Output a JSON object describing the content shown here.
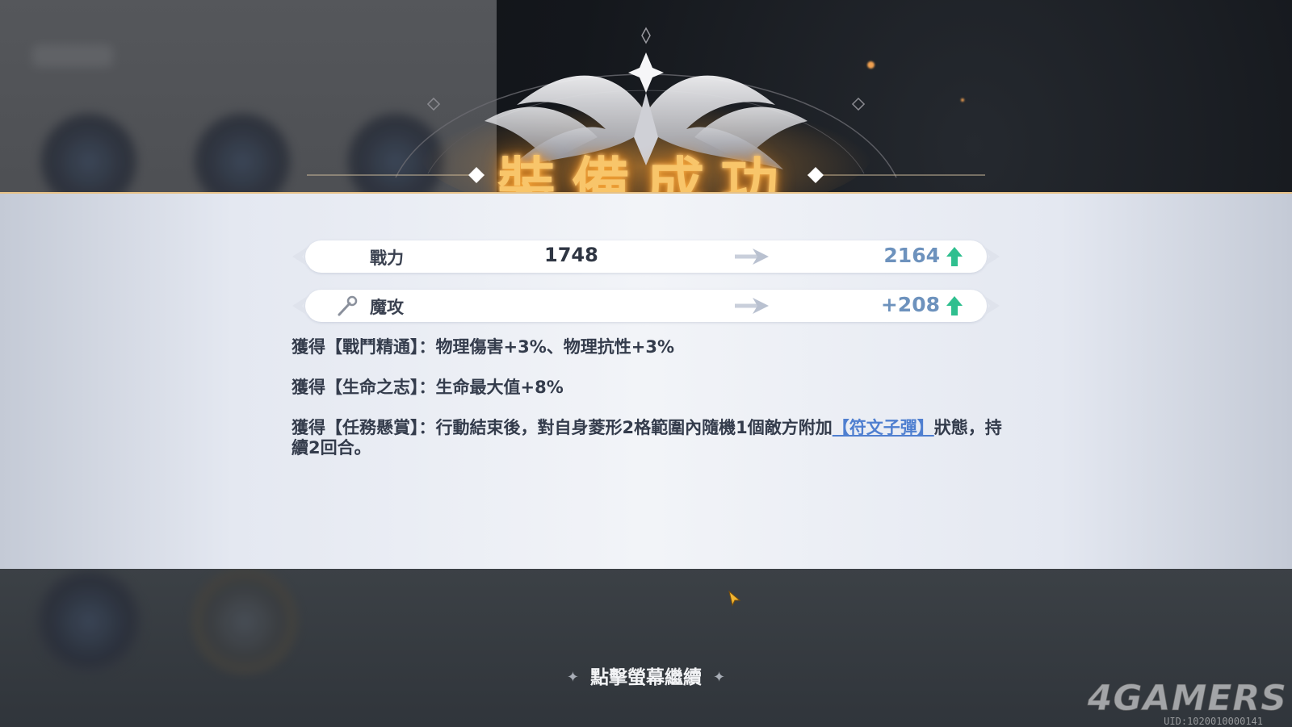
{
  "title": "裝備成功",
  "stats": [
    {
      "label": "戰力",
      "old_value": "1748",
      "new_value": "2164",
      "icon": "none",
      "trend": "up-arrow-icon"
    },
    {
      "label": "魔攻",
      "old_value": "",
      "new_value": "+208",
      "icon": "wand-icon",
      "trend": "up-arrow-icon"
    }
  ],
  "effects": [
    {
      "prefix": "獲得【戰鬥精通】：物理傷害+3%、物理抗性+3%",
      "keyword": "",
      "suffix": ""
    },
    {
      "prefix": "獲得【生命之志】：生命最大值+8%",
      "keyword": "",
      "suffix": ""
    },
    {
      "prefix": "獲得【任務懸賞】：行動結束後，對自身菱形2格範圍內隨機1個敵方附加",
      "keyword": "【符文子彈】",
      "suffix": "狀態，持續2回合。"
    }
  ],
  "continue_prompt": "點擊螢幕繼續",
  "watermark": "4GAMERS",
  "uid": "UID:1020010000141",
  "colors": {
    "title_glow": "#f8c56a",
    "new_value": "#6d92bd",
    "up_arrow": "#2fbf8f",
    "keyword_link": "#4f7fd0",
    "panel_border": "#e6c187"
  }
}
